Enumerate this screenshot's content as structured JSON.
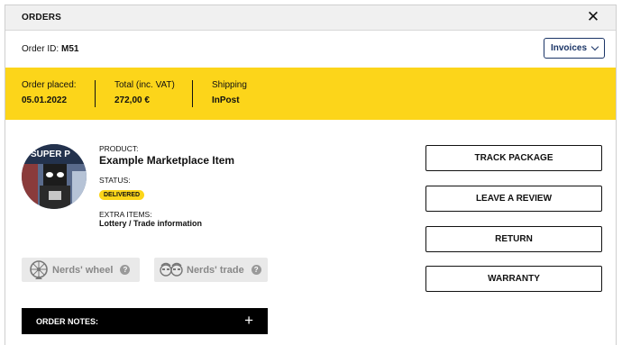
{
  "window": {
    "title": "ORDERS",
    "close_glyph": "✕"
  },
  "order": {
    "id_label": "Order ID:",
    "id_value": "M51",
    "invoices_label": "Invoices"
  },
  "summary": {
    "placed_label": "Order placed:",
    "placed_value": "05.01.2022",
    "total_label": "Total (inc. VAT)",
    "total_value": "272,00 €",
    "shipping_label": "Shipping",
    "shipping_value": "InPost"
  },
  "product": {
    "product_label": "PRODUCT:",
    "product_name": "Example Marketplace Item",
    "status_label": "STATUS:",
    "status_value": "DELIVERED",
    "extra_label": "EXTRA ITEMS:",
    "extra_value": "Lottery / Trade information",
    "avatar_text": "SUPER P"
  },
  "extras": [
    {
      "label": "Nerds' wheel",
      "icon": "wheel-icon"
    },
    {
      "label": "Nerds' trade",
      "icon": "nerds-trade-icon"
    }
  ],
  "help_glyph": "?",
  "notes": {
    "label": "ORDER NOTES:",
    "toggle_glyph": "+"
  },
  "actions": [
    {
      "label": "TRACK PACKAGE"
    },
    {
      "label": "LEAVE A REVIEW"
    },
    {
      "label": "RETURN"
    },
    {
      "label": "WARRANTY"
    }
  ],
  "colors": {
    "accent_yellow": "#fcd51a",
    "navy": "#1a3466",
    "black": "#000000"
  }
}
